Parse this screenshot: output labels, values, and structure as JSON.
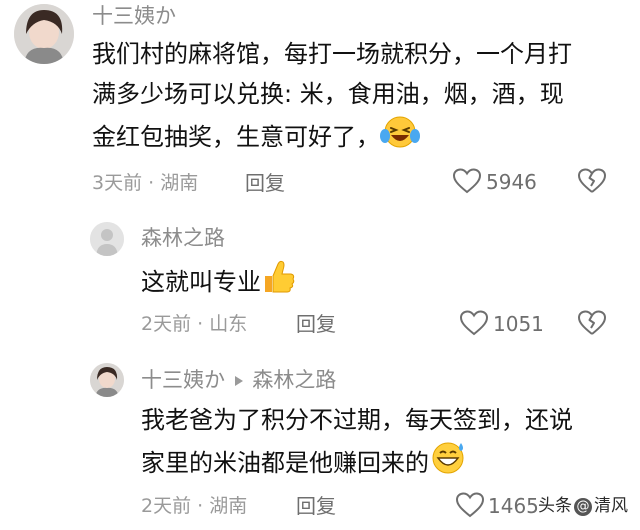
{
  "comments": [
    {
      "author": "十三姨か",
      "text_lines": [
        "我们村的麻将馆，每打一场就积分，一个月打",
        "满多少场可以兑换: 米，食用油，烟，酒，现",
        "金红包抽奖，生意可好了，"
      ],
      "text_emoji": "laughing-tears-emoji",
      "time": "3天前",
      "location": "湖南",
      "reply_label": "回复",
      "likes": "5946"
    },
    {
      "author": "森林之路",
      "text_lines": [
        "这就叫专业"
      ],
      "text_emoji": "thumbs-up-emoji",
      "time": "2天前",
      "location": "山东",
      "reply_label": "回复",
      "likes": "1051"
    },
    {
      "author": "十三姨か",
      "reply_to": "森林之路",
      "text_lines": [
        "我老爸为了积分不过期，每天签到，还说",
        "家里的米油都是他赚回来的"
      ],
      "text_emoji": "grinning-sweat-emoji",
      "time": "2天前",
      "location": "湖南",
      "reply_label": "回复",
      "likes": "1465"
    }
  ],
  "separator": "·",
  "watermark": {
    "prefix": "头条",
    "at": "@",
    "name": "清风"
  },
  "colors": {
    "text": "#111111",
    "meta": "#9a9a9a",
    "icon": "#6e6e6e"
  }
}
